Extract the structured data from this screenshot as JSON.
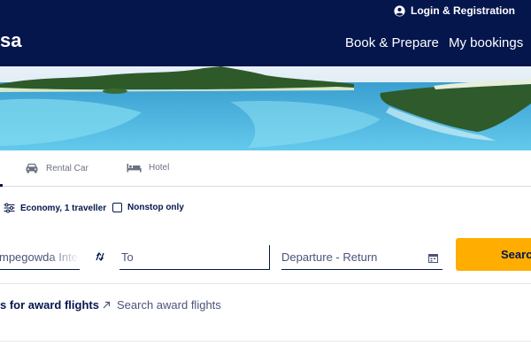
{
  "header": {
    "logo_text": "sa",
    "login_label": "Login & Registration",
    "nav": [
      "Book & Prepare",
      "My bookings"
    ]
  },
  "tabs": {
    "rental_car": "Rental Car",
    "hotel": "Hotel"
  },
  "options": {
    "cabin_travellers": "Economy, 1 traveller",
    "nonstop_label": "Nonstop only",
    "nonstop_checked": false
  },
  "form": {
    "from_value": "mpegowda Inte",
    "to_placeholder": "To",
    "dates_placeholder": "Departure - Return",
    "search_label": "Search"
  },
  "award": {
    "heading_fragment": "s for award flights",
    "link_label": "Search award flights"
  },
  "colors": {
    "brand_navy": "#05164d",
    "accent_yellow": "#ffad00"
  },
  "icons": [
    "user-icon",
    "car-icon",
    "bed-icon",
    "sliders-icon",
    "swap-icon",
    "calendar-icon",
    "arrow-up-right-icon"
  ]
}
